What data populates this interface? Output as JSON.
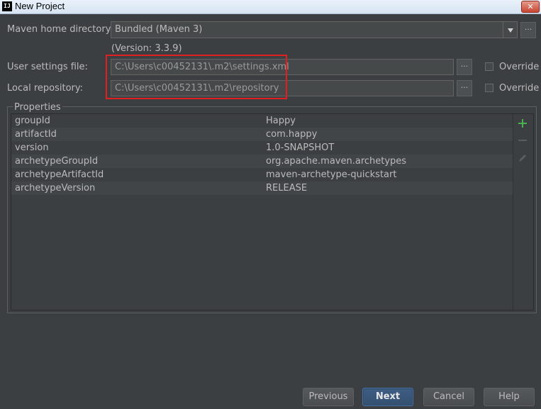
{
  "window": {
    "title": "New Project",
    "close_glyph": "✕"
  },
  "maven_home": {
    "label": "Maven home directory:",
    "value": "Bundled (Maven 3)",
    "version": "(Version: 3.3.9)"
  },
  "user_settings": {
    "label": "User settings file:",
    "value": "C:\\Users\\c00452131\\.m2\\settings.xml",
    "override_label": "Override",
    "override_checked": false
  },
  "local_repo": {
    "label": "Local repository:",
    "value": "C:\\Users\\c00452131\\.m2\\repository",
    "override_label": "Override",
    "override_checked": false
  },
  "browse_label": "...",
  "properties": {
    "title": "Properties",
    "rows": [
      {
        "key": "groupId",
        "value": "Happy"
      },
      {
        "key": "artifactId",
        "value": "com.happy"
      },
      {
        "key": "version",
        "value": "1.0-SNAPSHOT"
      },
      {
        "key": "archetypeGroupId",
        "value": "org.apache.maven.archetypes"
      },
      {
        "key": "archetypeArtifactId",
        "value": "maven-archetype-quickstart"
      },
      {
        "key": "archetypeVersion",
        "value": "RELEASE"
      }
    ],
    "toolbar": [
      "plus-icon",
      "minus-icon",
      "pencil-icon"
    ]
  },
  "buttons": {
    "previous": "Previous",
    "next": "Next",
    "cancel": "Cancel",
    "help": "Help"
  },
  "colors": {
    "background": "#3c3f41",
    "highlight_box": "#e02020",
    "add_icon": "#4caf50",
    "primary_button": "#3e5d85"
  }
}
